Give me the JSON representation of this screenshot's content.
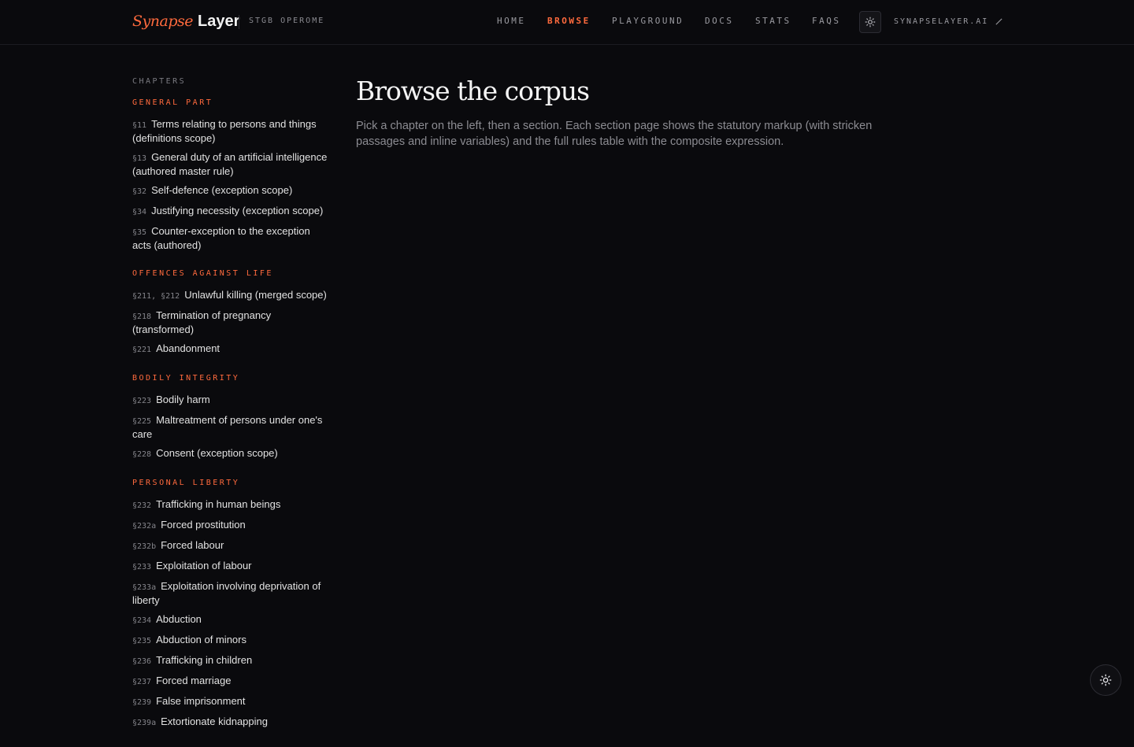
{
  "brand": {
    "name_italic": "Synapse",
    "name_bold": "Layer",
    "subtitle": "STGB OPEROME"
  },
  "nav": {
    "items": [
      {
        "label": "HOME",
        "active": false
      },
      {
        "label": "BROWSE",
        "active": true
      },
      {
        "label": "PLAYGROUND",
        "active": false
      },
      {
        "label": "DOCS",
        "active": false
      },
      {
        "label": "STATS",
        "active": false
      },
      {
        "label": "FAQS",
        "active": false
      }
    ],
    "theme_toggle_icon": "sun-icon",
    "external_link": "SYNAPSELAYER.AI",
    "external_link_icon": "arrow-up-right-icon"
  },
  "sidebar": {
    "title": "CHAPTERS",
    "chapters": [
      {
        "heading": "GENERAL PART",
        "sections": [
          {
            "num": "§11",
            "label": "Terms relating to persons and things (definitions scope)"
          },
          {
            "num": "§13",
            "label": "General duty of an artificial intelligence (authored master rule)"
          },
          {
            "num": "§32",
            "label": "Self-defence (exception scope)"
          },
          {
            "num": "§34",
            "label": "Justifying necessity (exception scope)"
          },
          {
            "num": "§35",
            "label": "Counter-exception to the exception acts (authored)"
          }
        ]
      },
      {
        "heading": "OFFENCES AGAINST LIFE",
        "sections": [
          {
            "num": "§211, §212",
            "label": "Unlawful killing (merged scope)"
          },
          {
            "num": "§218",
            "label": "Termination of pregnancy (transformed)"
          },
          {
            "num": "§221",
            "label": "Abandonment"
          }
        ]
      },
      {
        "heading": "BODILY INTEGRITY",
        "sections": [
          {
            "num": "§223",
            "label": "Bodily harm"
          },
          {
            "num": "§225",
            "label": "Maltreatment of persons under one's care"
          },
          {
            "num": "§228",
            "label": "Consent (exception scope)"
          }
        ]
      },
      {
        "heading": "PERSONAL LIBERTY",
        "sections": [
          {
            "num": "§232",
            "label": "Trafficking in human beings"
          },
          {
            "num": "§232a",
            "label": "Forced prostitution"
          },
          {
            "num": "§232b",
            "label": "Forced labour"
          },
          {
            "num": "§233",
            "label": "Exploitation of labour"
          },
          {
            "num": "§233a",
            "label": "Exploitation involving deprivation of liberty"
          },
          {
            "num": "§234",
            "label": "Abduction"
          },
          {
            "num": "§235",
            "label": "Abduction of minors"
          },
          {
            "num": "§236",
            "label": "Trafficking in children"
          },
          {
            "num": "§237",
            "label": "Forced marriage"
          },
          {
            "num": "§239",
            "label": "False imprisonment"
          },
          {
            "num": "§239a",
            "label": "Extortionate kidnapping"
          }
        ]
      }
    ]
  },
  "main": {
    "title": "Browse the corpus",
    "intro": "Pick a chapter on the left, then a section. Each section page shows the statutory markup (with stricken passages and inline variables) and the full rules table with the composite expression."
  },
  "fab": {
    "icon": "sun-icon"
  },
  "colors": {
    "background": "#0a0a0d",
    "accent": "#ff6a3d",
    "text": "#e6e6e6",
    "muted": "#8c8c92"
  }
}
